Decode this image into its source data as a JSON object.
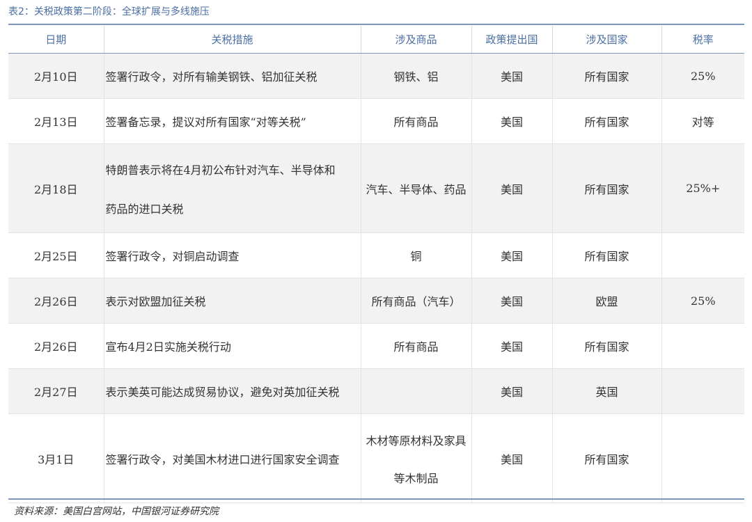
{
  "caption": "表2：关税政策第二阶段：全球扩展与多线施压",
  "headers": {
    "date": "日期",
    "measure": "关税措施",
    "goods": "涉及商品",
    "issuer": "政策提出国",
    "countries": "涉及国家",
    "rate": "税率"
  },
  "rows": [
    {
      "date": "2月10日",
      "measure": "签署行政令，对所有输美钢铁、铝加征关税",
      "goods": "钢铁、铝",
      "issuer": "美国",
      "countries": "所有国家",
      "rate": "25%"
    },
    {
      "date": "2月13日",
      "measure": "签署备忘录，提议对所有国家“对等关税”",
      "goods": "所有商品",
      "issuer": "美国",
      "countries": "所有国家",
      "rate": "对等"
    },
    {
      "date": "2月18日",
      "measure_line1": "特朗普表示将在4月初公布针对汽车、半导体和",
      "measure_line2": "药品的进口关税",
      "goods": "汽车、半导体、药品",
      "issuer": "美国",
      "countries": "所有国家",
      "rate": "25%+"
    },
    {
      "date": "2月25日",
      "measure": "签署行政令，对铜启动调查",
      "goods": "铜",
      "issuer": "美国",
      "countries": "所有国家",
      "rate": ""
    },
    {
      "date": "2月26日",
      "measure": "表示对欧盟加征关税",
      "goods": "所有商品（汽车）",
      "issuer": "美国",
      "countries": "欧盟",
      "rate": "25%"
    },
    {
      "date": "2月26日",
      "measure": "宣布4月2日实施关税行动",
      "goods": "所有商品",
      "issuer": "美国",
      "countries": "所有国家",
      "rate": ""
    },
    {
      "date": "2月27日",
      "measure": "表示美英可能达成贸易协议，避免对英加征关税",
      "goods": "",
      "issuer": "美国",
      "countries": "英国",
      "rate": ""
    },
    {
      "date": "3月1日",
      "measure": "签署行政令，对美国木材进口进行国家安全调查",
      "goods_line1": "木材等原材料及家具",
      "goods_line2": "等木制品",
      "issuer": "美国",
      "countries": "所有国家",
      "rate": ""
    }
  ],
  "source": "资料来源：美国白宫网站，中国银河证券研究院"
}
